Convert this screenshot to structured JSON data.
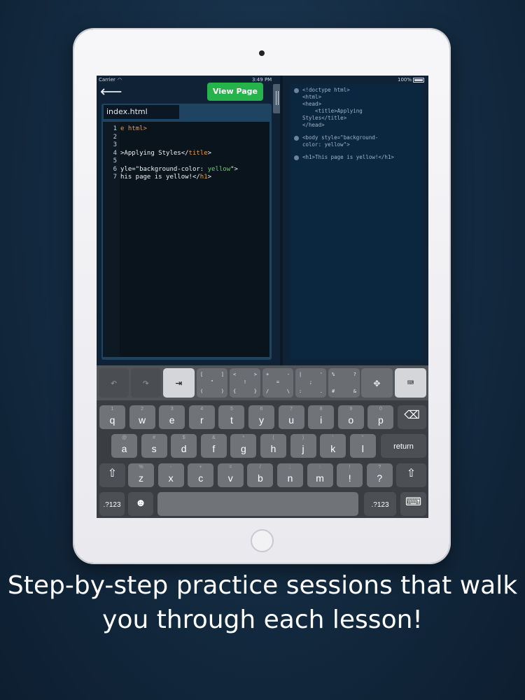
{
  "status_bar": {
    "carrier": "Carrier",
    "time": "3:49 PM",
    "battery": "100%"
  },
  "toolbar": {
    "view_page_label": "View Page"
  },
  "editor": {
    "filename": "index.html",
    "line_numbers": [
      "1",
      "2",
      "3",
      "4",
      "5",
      "6",
      "7"
    ],
    "lines": [
      [
        {
          "t": "e html>",
          "c": "tag"
        }
      ],
      [
        {
          "t": "",
          "c": ""
        }
      ],
      [
        {
          "t": "",
          "c": ""
        }
      ],
      [
        {
          "t": ">Applying Styles</",
          "c": ""
        },
        {
          "t": "title",
          "c": "tag"
        },
        {
          "t": ">",
          "c": ""
        }
      ],
      [
        {
          "t": "",
          "c": ""
        }
      ],
      [
        {
          "t": "yle=\"background-color: ",
          "c": ""
        },
        {
          "t": "yellow",
          "c": "str"
        },
        {
          "t": "\">",
          "c": ""
        }
      ],
      [
        {
          "t": "his page is yellow!</",
          "c": ""
        },
        {
          "t": "h1",
          "c": "tag"
        },
        {
          "t": ">",
          "c": ""
        }
      ]
    ]
  },
  "preview": {
    "blocks": [
      "<!doctype html>\n<html>\n<head>\n    <title>Applying\nStyles</title>\n</head>",
      "<body style=\"background-\ncolor: yellow\">",
      "<h1>This page is yellow!</h1>"
    ]
  },
  "shortcut_keys": [
    {
      "name": "undo-key",
      "glyph": "↶",
      "style": "dark"
    },
    {
      "name": "redo-key",
      "glyph": "↷",
      "style": "dark"
    },
    {
      "name": "tab-key",
      "glyph": "⇥",
      "style": "light"
    },
    {
      "name": "brackets-key",
      "corners": [
        "[",
        "]",
        "(",
        ")"
      ],
      "center": "\""
    },
    {
      "name": "angles-key",
      "corners": [
        "<",
        ">",
        "{",
        "}"
      ],
      "center": "!"
    },
    {
      "name": "math-key",
      "corners": [
        "+",
        "-",
        "/",
        "\\"
      ],
      "center": "="
    },
    {
      "name": "punct-key",
      "corners": [
        "|",
        "'",
        ":",
        "."
      ],
      "center": ";"
    },
    {
      "name": "symbols-key",
      "corners": [
        "%",
        "?",
        "#",
        "&"
      ],
      "center": ""
    },
    {
      "name": "arrows-key",
      "glyph": "✥"
    },
    {
      "name": "hide-keyboard-key",
      "glyph": "⌨",
      "style": "light"
    }
  ],
  "keyboard": {
    "row1": [
      {
        "k": "q",
        "s": "1"
      },
      {
        "k": "w",
        "s": "2"
      },
      {
        "k": "e",
        "s": "3"
      },
      {
        "k": "r",
        "s": "4"
      },
      {
        "k": "t",
        "s": "5"
      },
      {
        "k": "y",
        "s": "6"
      },
      {
        "k": "u",
        "s": "7"
      },
      {
        "k": "i",
        "s": "8"
      },
      {
        "k": "o",
        "s": "9"
      },
      {
        "k": "p",
        "s": "0"
      }
    ],
    "row2": [
      {
        "k": "a",
        "s": "@"
      },
      {
        "k": "s",
        "s": "#"
      },
      {
        "k": "d",
        "s": "$"
      },
      {
        "k": "f",
        "s": "&"
      },
      {
        "k": "g",
        "s": "*"
      },
      {
        "k": "h",
        "s": "("
      },
      {
        "k": "j",
        "s": ")"
      },
      {
        "k": "k",
        "s": "'"
      },
      {
        "k": "l",
        "s": "\""
      }
    ],
    "row3": [
      {
        "k": "z",
        "s": "%"
      },
      {
        "k": "x",
        "s": "-"
      },
      {
        "k": "c",
        "s": "+"
      },
      {
        "k": "v",
        "s": "="
      },
      {
        "k": "b",
        "s": "/"
      },
      {
        "k": "n",
        "s": ";"
      },
      {
        "k": "m",
        "s": ":"
      },
      {
        "k": "!",
        "s": "!"
      },
      {
        "k": "?",
        "s": "?"
      }
    ],
    "return_label": "return",
    "numbers_label": ".?123",
    "delete_glyph": "⌫",
    "shift_glyph": "⇧",
    "emoji_glyph": "☻",
    "dismiss_glyph": "⌨"
  },
  "caption": "Step-by-step practice sessions that walk you through each lesson!"
}
